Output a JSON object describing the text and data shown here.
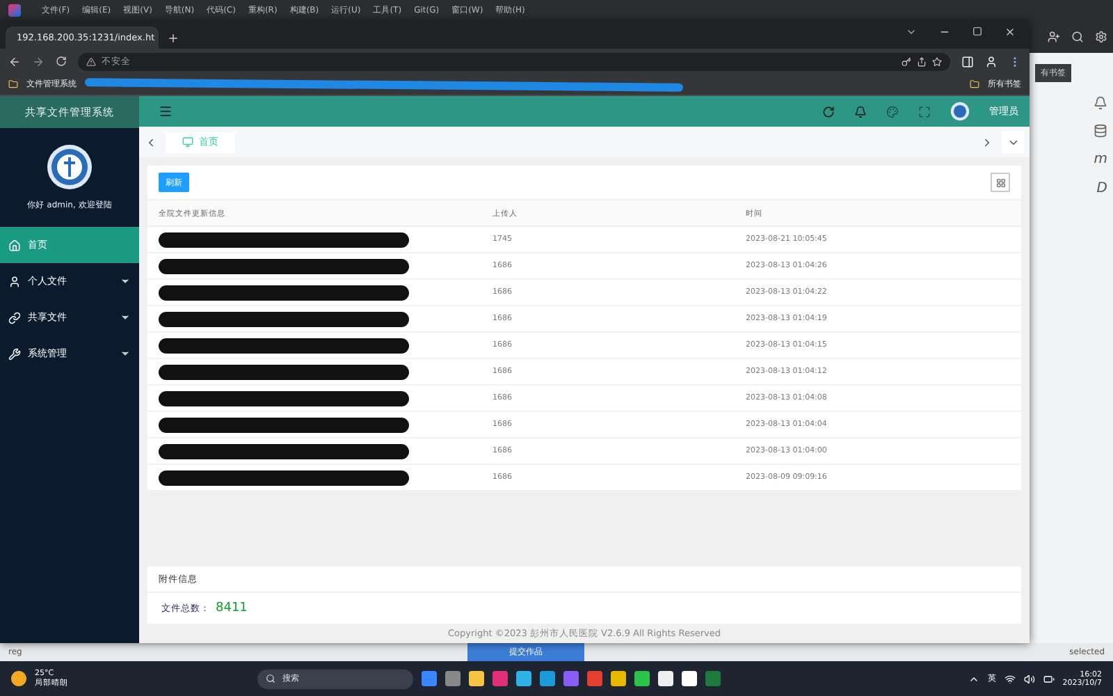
{
  "ide": {
    "menu": [
      "文件(F)",
      "编辑(E)",
      "视图(V)",
      "导航(N)",
      "代码(C)",
      "重构(R)",
      "构建(B)",
      "运行(U)",
      "工具(T)",
      "Git(G)",
      "窗口(W)",
      "帮助(H)"
    ],
    "side_letters": [
      "m",
      "D"
    ],
    "behind_text": "有书签",
    "status_left": "reg",
    "status_right": "selected",
    "submit_button": "提交作品"
  },
  "browser": {
    "tab_title": "192.168.200.35:1231/index.ht",
    "security": "不安全",
    "bookmarks": [
      {
        "kind": "link",
        "label": "文件管理系统"
      },
      {
        "kind": "redacted"
      }
    ],
    "all_bookmarks": "所有书签"
  },
  "app": {
    "title": "共享文件管理系统",
    "greeting": "你好 admin, 欢迎登陆",
    "user": "管理员",
    "nav": [
      {
        "label": "首页",
        "kind": "home",
        "selected": true,
        "expandable": false
      },
      {
        "label": "个人文件",
        "kind": "user",
        "selected": false,
        "expandable": true
      },
      {
        "label": "共享文件",
        "kind": "link",
        "selected": false,
        "expandable": true
      },
      {
        "label": "系统管理",
        "kind": "tools",
        "selected": false,
        "expandable": true
      }
    ],
    "tabs": [
      {
        "label": "首页",
        "selected": true
      }
    ],
    "refresh_button": "刷新",
    "table": {
      "columns": [
        "全院文件更新信息",
        "上传人",
        "时间"
      ],
      "rows": [
        {
          "redacted": true,
          "uploader": "1745",
          "time": "2023-08-21 10:05:45"
        },
        {
          "redacted": true,
          "uploader": "1686",
          "time": "2023-08-13 01:04:26"
        },
        {
          "redacted": true,
          "uploader": "1686",
          "time": "2023-08-13 01:04:22"
        },
        {
          "redacted": true,
          "uploader": "1686",
          "time": "2023-08-13 01:04:19"
        },
        {
          "redacted": true,
          "uploader": "1686",
          "time": "2023-08-13 01:04:15"
        },
        {
          "redacted": true,
          "uploader": "1686",
          "time": "2023-08-13 01:04:12"
        },
        {
          "redacted": true,
          "uploader": "1686",
          "time": "2023-08-13 01:04:08"
        },
        {
          "redacted": true,
          "uploader": "1686",
          "time": "2023-08-13 01:04:04"
        },
        {
          "redacted": true,
          "uploader": "1686",
          "time": "2023-08-13 01:04:00"
        },
        {
          "redacted": true,
          "uploader": "1686",
          "time": "2023-08-09 09:09:16"
        }
      ]
    },
    "info": {
      "title": "附件信息",
      "stats": [
        {
          "label": "文件总数：",
          "value": "8411"
        }
      ]
    },
    "footer": "Copyright ©2023 彭州市人民医院 V2.6.9 All Rights Reserved"
  },
  "taskbar": {
    "temperature": "25°C",
    "weather": "局部晴朗",
    "search": "搜索",
    "language": "英",
    "time": "16:02",
    "date": "2023/10/7"
  }
}
